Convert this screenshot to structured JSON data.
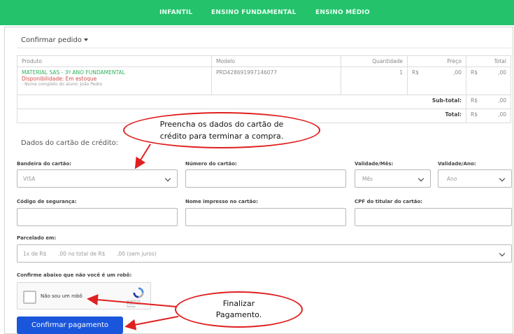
{
  "nav": {
    "items": [
      "INFANTIL",
      "ENSINO FUNDAMENTAL",
      "ENSINO MÉDIO"
    ]
  },
  "order": {
    "title": "Confirmar pedido",
    "headers": {
      "produto": "Produto",
      "modelo": "Modelo",
      "quantidade": "Quantidade",
      "preco": "Preço",
      "total": "Total"
    },
    "product": {
      "name": "MATERIAL SAS - 3º ANO FUNDAMENTAL",
      "availability": "Disponibilidade: Em estoque",
      "note": "- Nome completo do aluno: João Pedro",
      "model": "PRD428691997146077",
      "quantity": "1",
      "price_currency": "R$",
      "price_value": ",00",
      "total_currency": "R$",
      "total_value": ",00"
    },
    "subtotal": {
      "label": "Sub-total:",
      "currency": "R$",
      "value": ",00"
    },
    "total": {
      "label": "Total:",
      "currency": "R$",
      "value": ",00"
    }
  },
  "card": {
    "section_title": "Dados do cartão de crédito:",
    "brand_label": "Bandeira do cartão:",
    "brand_value": "VISA",
    "number_label": "Número do cartão:",
    "month_label": "Validade/Mês:",
    "month_placeholder": "Mês",
    "year_label": "Validade/Ano:",
    "year_placeholder": "Ano",
    "cvv_label": "Código de segurança:",
    "name_label": "Nome impresso no cartão:",
    "cpf_label": "CPF do titular do cartão:",
    "installments_label": "Parcelado em:",
    "installments_value": "1x de R$       ,00 no total de R$       ,00 (sem juros)"
  },
  "captcha": {
    "label": "Confirme abaixo que não você é um robô:",
    "checkbox_text": "Não sou um robô",
    "brand": "reCAPTCHA",
    "brand_links": "Privacidade - Termos"
  },
  "pay_button": "Confirmar pagamento",
  "annotations": {
    "callout1_line1": "Preencha os dados do cartão de",
    "callout1_line2": "crédito para terminar a compra.",
    "callout2_line1": "Finalizar",
    "callout2_line2": "Pagamento."
  },
  "colors": {
    "nav": "#23c26b",
    "product": "#2fb25e",
    "stock": "#d04a4a",
    "button": "#1a56db",
    "annotation": "#e02020"
  }
}
